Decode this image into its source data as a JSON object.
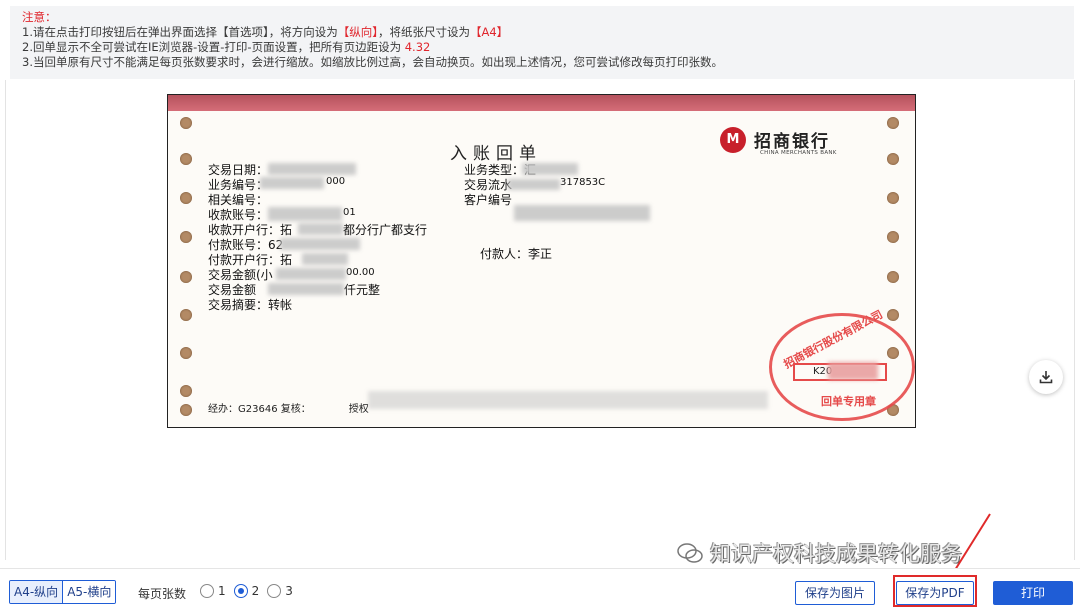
{
  "notice": {
    "title": "注意：",
    "line1_a": "1.请在点击打印按钮后在弹出界面选择【首选项】，将方向设为",
    "line1_b": "【纵向】",
    "line1_c": "，将纸张尺寸设为",
    "line1_d": "【A4】",
    "line2_a": "2.回单显示不全可尝试在IE浏览器-设置-打印-页面设置，把所有页边距设为",
    "line2_b": " 4.32",
    "line3": "3.当回单原有尺寸不能满足每页张数要求时，会进行缩放。如缩放比例过高，会自动换页。如出现上述情况，您可尝试修改每页打印张数。"
  },
  "receipt": {
    "title": "入账回单",
    "bank_name": "招商银行",
    "bank_en": "CHINA MERCHANTS BANK",
    "left_fields": [
      "交易日期：",
      "业务编号：",
      "相关编号：",
      "收款账号：",
      "收款开户行：拓",
      "付款账号：62",
      "付款开户行：拓",
      "交易金额(小",
      "交易金额",
      "交易摘要：转帐"
    ],
    "partial": {
      "biz_no_tail": "000",
      "acct_tail": "01",
      "bank_tail": "都分行广都支行",
      "amount_tail": "00.00",
      "amount_cn_tail": "仟元整"
    },
    "right_fields": {
      "biz_type": "业务类型：汇",
      "serial": "交易流水",
      "serial_tail": "317853C",
      "customer_no": "客户编号",
      "payer": "付款人：李正"
    },
    "footer": {
      "handler": "经办：G23646 复核：",
      "auth": "授权"
    },
    "seal": {
      "top_text": "招商银行股份有限公司",
      "box_text": "K20",
      "bottom_text": "回单专用章"
    }
  },
  "watermark": "知识产权科技成果转化服务",
  "toolbar": {
    "a4_portrait": "A4-纵向",
    "a5_landscape": "A5-横向",
    "per_page_label": "每页张数",
    "options": [
      "1",
      "2",
      "3"
    ],
    "selected": "2",
    "save_image": "保存为图片",
    "save_pdf": "保存为PDF",
    "print": "打印"
  },
  "colors": {
    "accent": "#1f5dd6",
    "warning_red": "#e0262d",
    "annotation_red": "#e02a2a",
    "seal_red": "#e54a4a"
  },
  "icons": {
    "download": "download-icon",
    "bank_logo": "cmb-logo-icon",
    "wechat": "wechat-icon"
  }
}
